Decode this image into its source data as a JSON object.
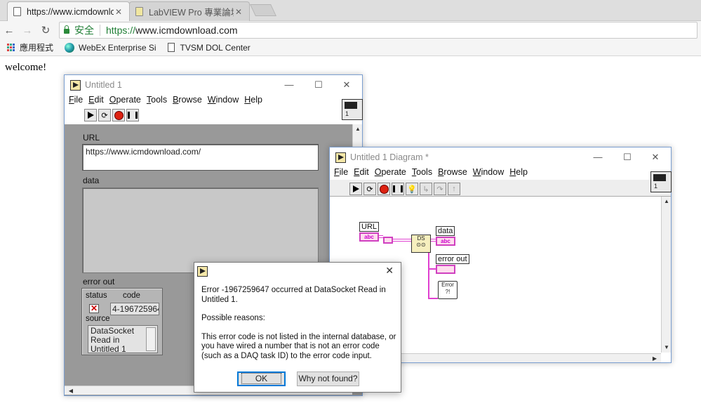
{
  "browser": {
    "tabs": [
      {
        "title": "https://www.icmdownlo",
        "active": true
      },
      {
        "title": "LabVIEW Pro 專業論壇 -",
        "active": false
      }
    ],
    "url_secure_label": "安全",
    "url_scheme": "https://",
    "url_host": "www.icmdownload.com",
    "bookmarks": [
      "應用程式",
      "WebEx Enterprise Si",
      "TVSM DOL Center"
    ],
    "tab_close": "✕"
  },
  "page": {
    "welcome": "welcome!"
  },
  "front_panel": {
    "title": "Untitled 1",
    "menu": [
      "File",
      "Edit",
      "Operate",
      "Tools",
      "Browse",
      "Window",
      "Help"
    ],
    "url_label": "URL",
    "url_value": "https://www.icmdownload.com/",
    "data_label": "data",
    "error_out_label": "error out",
    "status_label": "status",
    "code_label": "code",
    "code_value": "4-196725964",
    "source_label": "source",
    "source_value": "DataSocket Read in Untitled 1"
  },
  "diagram": {
    "title": "Untitled 1 Diagram *",
    "menu": [
      "File",
      "Edit",
      "Operate",
      "Tools",
      "Browse",
      "Window",
      "Help"
    ],
    "url_terminal": "URL",
    "data_terminal": "data",
    "error_out_terminal": "error out",
    "abc_tag": "abc",
    "error_node_text": "Error ?!"
  },
  "dialog": {
    "line1": "Error -1967259647 occurred at DataSocket Read in Untitled 1.",
    "line2": "Possible reasons:",
    "line3": "This error code is not listed in the internal database, or you have wired a number that is not an error code (such as a DAQ task ID) to the error code input.",
    "ok_label": "OK",
    "why_label": "Why not found?"
  },
  "window_controls": {
    "minimize": "—",
    "maximize": "☐",
    "close": "✕"
  }
}
